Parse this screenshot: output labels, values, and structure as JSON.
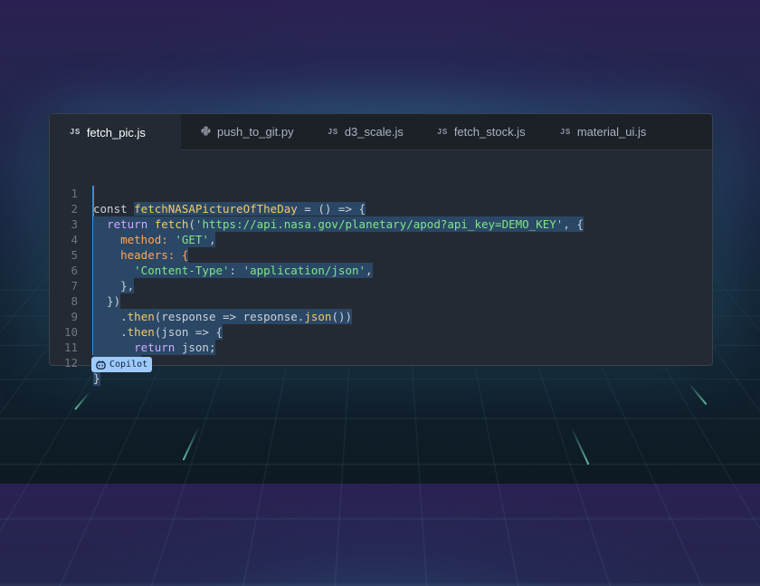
{
  "tabs": [
    {
      "label": "fetch_pic.js",
      "icon_text": "JS",
      "icon": "js-icon",
      "active": true
    },
    {
      "label": "push_to_git.py",
      "icon_text": "",
      "icon": "python-icon",
      "active": false
    },
    {
      "label": "d3_scale.js",
      "icon_text": "JS",
      "icon": "js-icon",
      "active": false
    },
    {
      "label": "fetch_stock.js",
      "icon_text": "JS",
      "icon": "js-icon",
      "active": false
    },
    {
      "label": "material_ui.js",
      "icon_text": "JS",
      "icon": "js-icon",
      "active": false
    }
  ],
  "code": {
    "line_numbers": [
      "1",
      "2",
      "3",
      "4",
      "5",
      "6",
      "7",
      "8",
      "9",
      "10",
      "11",
      "12"
    ],
    "lines": [
      {
        "t1": "const ",
        "t2": "fetchNASAPictureOfTheDay",
        "t3": " = () => {"
      },
      {
        "t1": "  ",
        "t2": "return",
        "t3": " ",
        "t4": "fetch",
        "t5": "(",
        "t6": "'https://api.nasa.gov/planetary/apod?api_key=DEMO_KEY'",
        "t7": ", {"
      },
      {
        "t1": "    method: ",
        "t2": "'GET'",
        "t3": ","
      },
      {
        "t1": "    headers: {"
      },
      {
        "t1": "      ",
        "t2": "'Content-Type'",
        "t3": ": ",
        "t4": "'application/json'",
        "t5": ","
      },
      {
        "t1": "    },"
      },
      {
        "t1": "  })"
      },
      {
        "t1": "    .",
        "t2": "then",
        "t3": "(response => response.",
        "t4": "json",
        "t5": "())"
      },
      {
        "t1": "    .",
        "t2": "then",
        "t3": "(json => {"
      },
      {
        "t1": "      ",
        "t2": "return",
        "t3": " json;"
      },
      {
        "t1": "    });"
      },
      {
        "t1": "}"
      }
    ]
  },
  "copilot": {
    "label": "Copilot",
    "icon": "copilot-icon"
  },
  "colors": {
    "accent": "#3b8fd6",
    "selection": "#2b4766",
    "badge": "#9ecbff"
  }
}
